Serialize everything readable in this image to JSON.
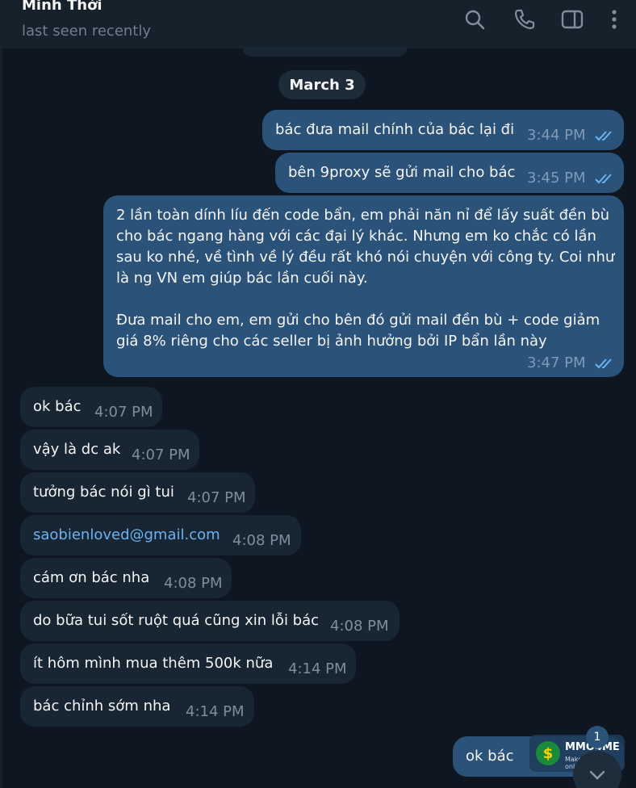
{
  "header": {
    "contact_name": "Minh Thời",
    "status": "last seen recently",
    "icons": [
      "search-icon",
      "phone-icon",
      "sidebar-toggle-icon",
      "more-vertical-icon"
    ]
  },
  "date_separator": "March 3",
  "messages": [
    {
      "direction": "out",
      "text": "bác đưa mail chính của bác lại đi",
      "time": "3:44 PM",
      "read": true
    },
    {
      "direction": "out",
      "text": "bên 9proxy sẽ gửi mail cho bác",
      "time": "3:45 PM",
      "read": true
    },
    {
      "direction": "out",
      "paragraphs": [
        "2 lần toàn dính líu đến code bẩn, em phải năn nỉ để lấy suất đền bù cho bác ngang hàng với các đại lý khác. Nhưng em ko chắc có lần sau ko nhé, về tình về lý đều rất khó nói chuyện với công ty. Coi như là ng VN em giúp bác lần cuối này.",
        "Đưa mail cho em, em gửi cho bên đó gửi mail đền bù + code giảm giá 8% riêng cho các seller bị ảnh hưởng bởi IP bẩn lần này"
      ],
      "time": "3:47 PM",
      "read": true
    },
    {
      "direction": "in",
      "text": "ok bác",
      "time": "4:07 PM"
    },
    {
      "direction": "in",
      "text": "vậy là dc ak",
      "time": "4:07 PM"
    },
    {
      "direction": "in",
      "text": "tưởng bác nói gì tui",
      "time": "4:07 PM"
    },
    {
      "direction": "in",
      "text": "saobienloved@gmail.com",
      "time": "4:08 PM",
      "is_link": true
    },
    {
      "direction": "in",
      "text": "cám ơn bác nha",
      "time": "4:08 PM"
    },
    {
      "direction": "in",
      "text": "do bữa tui sốt ruột quá cũng xin lỗi bác",
      "time": "4:08 PM"
    },
    {
      "direction": "in",
      "text": "ít hôm mình mua thêm 500k nữa",
      "time": "4:14 PM"
    },
    {
      "direction": "in",
      "text": "bác chỉnh sớm nha",
      "time": "4:14 PM"
    },
    {
      "direction": "out",
      "text": "ok bác",
      "time": ""
    }
  ],
  "unread_badge": "1",
  "watermark": {
    "title": "MMO4ME",
    "subtitle": "Make money online"
  },
  "colors": {
    "background": "#0e1621",
    "header": "#17212b",
    "outgoing": "#2b5278",
    "incoming": "#182533",
    "link": "#6ab3f3"
  }
}
